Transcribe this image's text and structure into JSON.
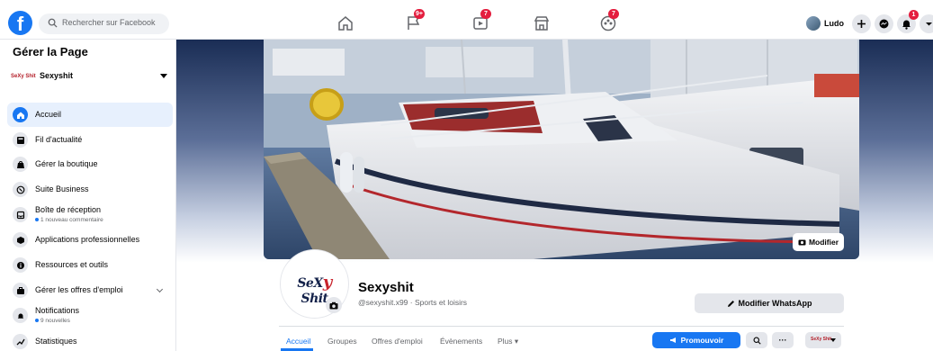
{
  "topbar": {
    "logo": "f",
    "search_placeholder": "Rechercher sur Facebook",
    "nav": [
      {
        "icon": "home-icon",
        "badge": ""
      },
      {
        "icon": "flag-icon",
        "badge": "9+"
      },
      {
        "icon": "video-icon",
        "badge": "7"
      },
      {
        "icon": "marketplace-icon",
        "badge": ""
      },
      {
        "icon": "groups-icon",
        "badge": "7"
      }
    ],
    "user_name": "Ludo",
    "notifications_badge": "1"
  },
  "sidebar": {
    "title": "Gérer la Page",
    "page_name": "Sexyshit",
    "page_logo_text": "SeXy Shit",
    "items": [
      {
        "label": "Accueil",
        "icon": "home-icon"
      },
      {
        "label": "Fil d'actualité",
        "icon": "news-feed-icon"
      },
      {
        "label": "Gérer la boutique",
        "icon": "shop-icon"
      },
      {
        "label": "Suite Business",
        "icon": "business-suite-icon"
      },
      {
        "label": "Boîte de réception",
        "icon": "inbox-icon",
        "sub": "1 nouveau commentaire"
      },
      {
        "label": "Applications professionnelles",
        "icon": "apps-icon"
      },
      {
        "label": "Ressources et outils",
        "icon": "info-icon"
      },
      {
        "label": "Gérer les offres d'emploi",
        "icon": "jobs-icon"
      },
      {
        "label": "Notifications",
        "icon": "bell-icon",
        "sub": "9 nouvelles"
      },
      {
        "label": "Statistiques",
        "icon": "insights-icon"
      }
    ]
  },
  "cover": {
    "edit_label": "Modifier"
  },
  "profile": {
    "logo_left": "SeX",
    "logo_x": "y",
    "logo_right": " Shit",
    "name": "Sexyshit",
    "subtitle": "@sexyshit.x99 · Sports et loisirs",
    "whatsapp_label": "Modifier WhatsApp"
  },
  "tabs": [
    "Accueil",
    "Groupes",
    "Offres d'emploi",
    "Évènements",
    "Plus ▾"
  ],
  "actions": {
    "promote_label": "Promouvoir",
    "more_label": "···",
    "mini_logo": "SeXy Shit"
  },
  "colors": {
    "accent": "#1877f2",
    "badge": "#e41e3f",
    "active_bg": "#e7f0fd"
  }
}
